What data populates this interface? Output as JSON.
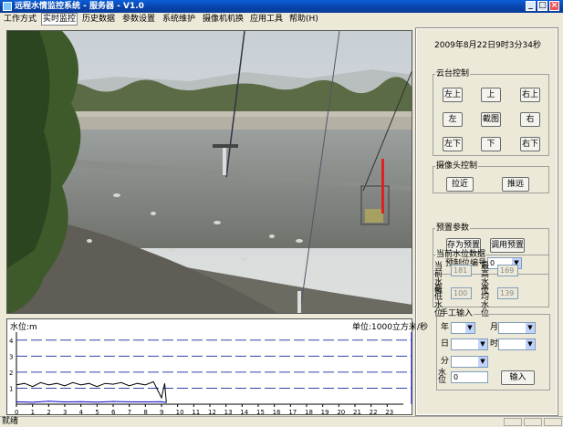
{
  "window": {
    "title": "远程水情监控系统 - 服务器 - V1.0"
  },
  "menu": [
    "工作方式",
    "实时监控",
    "历史数据",
    "参数设置",
    "系统维护",
    "摄像机机换",
    "应用工具",
    "帮助(H)"
  ],
  "video": {
    "description": "camera feed"
  },
  "chart": {
    "unit_left": "水位:m",
    "unit_right": "单位:1000立方米/秒"
  },
  "chart_data": {
    "type": "line",
    "x_ticks": [
      0,
      1,
      2,
      3,
      4,
      5,
      6,
      7,
      8,
      9,
      10,
      11,
      12,
      13,
      14,
      15,
      16,
      17,
      18,
      19,
      20,
      21,
      22,
      23
    ],
    "y_ticks": [
      1,
      2,
      3,
      4
    ],
    "ylim": [
      0,
      4.5
    ],
    "xlim": [
      0,
      24
    ],
    "series": [
      {
        "color": "#000000",
        "x": [
          0,
          0.5,
          1,
          1.5,
          2,
          2.5,
          3,
          3.5,
          4,
          4.5,
          5,
          5.5,
          6,
          6.5,
          7,
          7.5,
          8,
          8.5,
          9,
          9.2,
          9.3
        ],
        "y": [
          1.2,
          1.3,
          1.1,
          1.35,
          1.2,
          1.3,
          1.15,
          1.35,
          1.2,
          1.3,
          1.1,
          1.3,
          1.25,
          1.35,
          1.15,
          1.3,
          1.2,
          1.4,
          0.4,
          1.3,
          0.1
        ]
      },
      {
        "color": "#0000cc",
        "x": [
          0,
          1,
          2,
          3,
          4,
          5,
          6,
          7,
          8,
          9,
          9.3
        ],
        "y": [
          0.15,
          0.12,
          0.18,
          0.14,
          0.16,
          0.13,
          0.17,
          0.15,
          0.14,
          0.16,
          0.1
        ]
      }
    ]
  },
  "panel": {
    "datetime": "2009年8月22日9时3分34秒",
    "ptz": {
      "legend": "云台控制",
      "left_up": "左上",
      "up": "上",
      "right_up": "右上",
      "left": "左",
      "capture": "截图",
      "right": "右",
      "left_down": "左下",
      "down": "下",
      "right_down": "右下"
    },
    "lens": {
      "legend": "摄像头控制",
      "zoom_in": "拉近",
      "zoom_out": "推远"
    },
    "preset": {
      "legend": "预置参数",
      "save": "存为预置",
      "call": "调用预置",
      "num_label": "预制位编号",
      "num_value": "0"
    },
    "water": {
      "legend": "当前水位数据",
      "cur_label": "当前水位",
      "cur_value": "181",
      "high_label": "最高水位",
      "high_value": "169",
      "low_label": "最低水位",
      "low_value": "100",
      "avg_label": "平均水位",
      "avg_value": "139"
    },
    "manual": {
      "legend": "手工输入",
      "year": "年",
      "month": "月",
      "day": "日",
      "hour": "时",
      "minute": "分",
      "level": "水位",
      "level_value": "0",
      "input": "输入"
    }
  },
  "status": {
    "text": "就绪"
  }
}
